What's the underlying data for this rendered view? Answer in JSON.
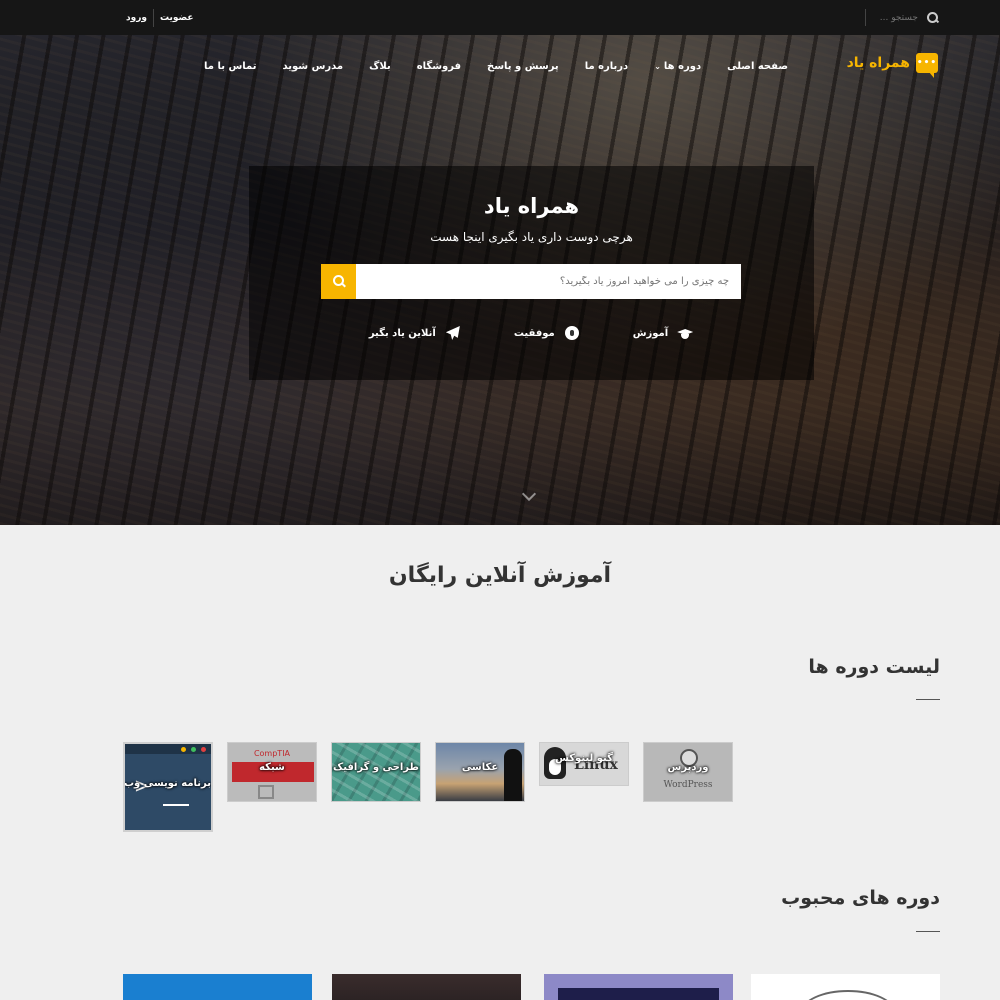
{
  "topbar": {
    "login": "ورود",
    "register": "عضویت",
    "search_placeholder": "جستجو ..."
  },
  "nav": {
    "logo_text": "همراه یاد",
    "items": [
      {
        "label": "صفحه اصلی"
      },
      {
        "label": "دوره ها",
        "has_dropdown": true
      },
      {
        "label": "درباره ما"
      },
      {
        "label": "پرسش و پاسخ"
      },
      {
        "label": "فروشگاه"
      },
      {
        "label": "بلاگ"
      },
      {
        "label": "مدرس شوید"
      },
      {
        "label": "تماس با ما"
      }
    ]
  },
  "hero": {
    "title": "همراه یاد",
    "subtitle": "هرچی دوست داری یاد بگیری اینجا هست",
    "search_placeholder": "چه چیزی را می خواهید امروز یاد بگیرید؟",
    "features": [
      {
        "label": "آموزش",
        "icon": "graduation-cap-icon"
      },
      {
        "label": "موفقیت",
        "icon": "rebel-icon"
      },
      {
        "label": "آنلاین یاد بگیر",
        "icon": "paper-plane-icon"
      }
    ]
  },
  "main": {
    "section_title": "آموزش آنلاین رایگان",
    "courses_title": "لیست دوره ها",
    "courses": [
      {
        "label": "وردپرس",
        "brand": "WordPress"
      },
      {
        "label": "گنو لینوکس",
        "brand": "Linux"
      },
      {
        "label": "عکاسی"
      },
      {
        "label": "طراحی و گرافیک"
      },
      {
        "label": "شبکه",
        "brand": "CompTIA"
      },
      {
        "label": "برنامه نویسی وب",
        "brand": ">"
      }
    ],
    "popular_title": "دوره های محبوب"
  },
  "colors": {
    "accent": "#f7b500",
    "topbar": "#161616",
    "page_bg": "#efefef"
  }
}
